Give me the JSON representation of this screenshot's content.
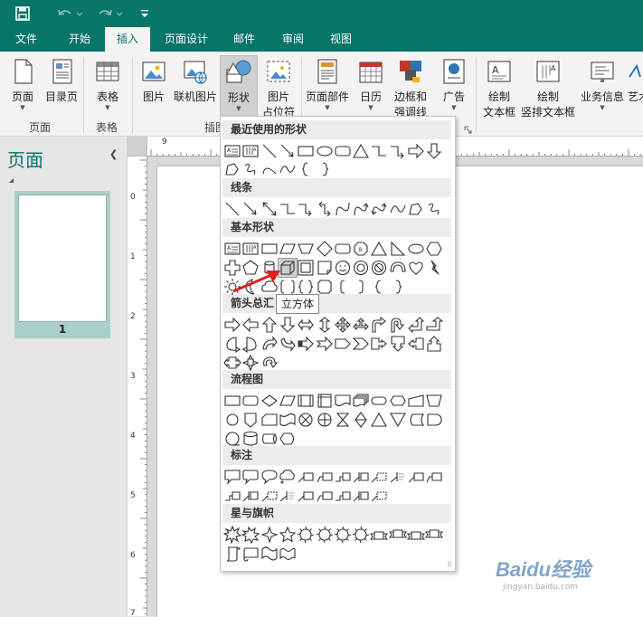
{
  "tabs": [
    "文件",
    "开始",
    "插入",
    "页面设计",
    "邮件",
    "审阅",
    "视图"
  ],
  "active_tab": "插入",
  "ribbon": {
    "buttons": {
      "page": "页面",
      "toc": "目录页",
      "table": "表格",
      "picture": "图片",
      "online_picture": "联机图片",
      "shapes": "形状",
      "picture_placeholder_1": "图片",
      "picture_placeholder_2": "占位符",
      "page_parts": "页面部件",
      "calendar": "日历",
      "borders_1": "边框和",
      "borders_2": "强调线",
      "ad": "广告",
      "textbox_1": "绘制",
      "textbox_2": "文本框",
      "vtextbox_1": "绘制",
      "vtextbox_2": "竖排文本框",
      "business_info": "业务信息",
      "art": "艺术"
    },
    "groups": {
      "pages": "页面",
      "tables": "表格",
      "illustrations": "插图"
    }
  },
  "left_pane": {
    "title": "页面",
    "thumb_number": "1"
  },
  "shapes_menu": {
    "sections": [
      "最近使用的形状",
      "线条",
      "基本形状",
      "箭头总汇",
      "流程图",
      "标注",
      "星与旗帜"
    ],
    "hovered_shape": "cube",
    "tooltip": "立方体"
  },
  "ruler": {
    "h_labels": [
      "9"
    ],
    "v_labels": [
      "0",
      "1",
      "2",
      "3",
      "4",
      "5",
      "6",
      "7"
    ]
  },
  "watermark": {
    "logo": "Baidu经验",
    "url": "jingyan.baidu.com"
  },
  "colors": {
    "brand": "#077568",
    "accent_red": "#e02020"
  }
}
